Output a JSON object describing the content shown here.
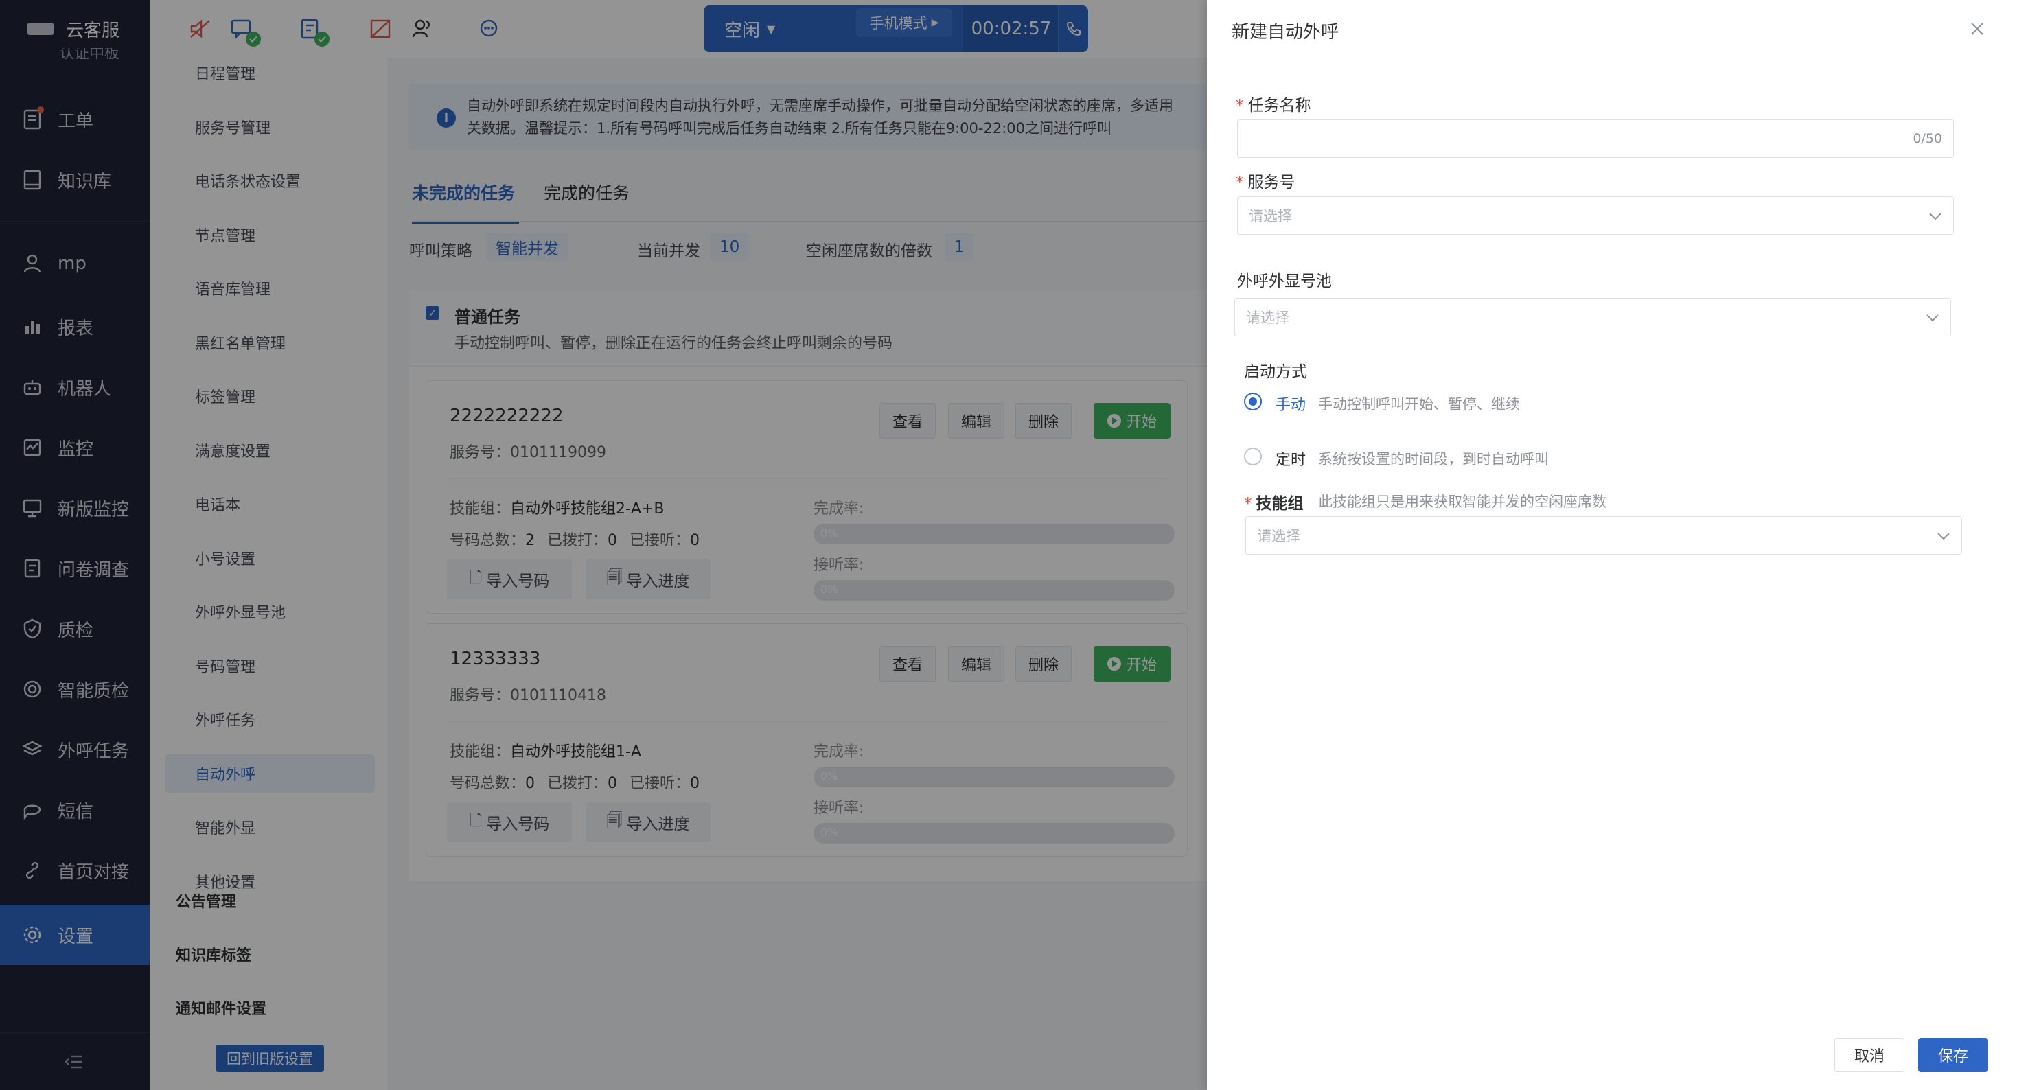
{
  "brand": {
    "title": "云客服",
    "partial_above": "认证中板"
  },
  "nav": {
    "items": [
      {
        "label": "工单",
        "icon": "ticket-icon"
      },
      {
        "label": "知识库",
        "icon": "book-icon"
      },
      {
        "label": "mp",
        "icon": "user-icon"
      },
      {
        "label": "报表",
        "icon": "bar-chart-icon"
      },
      {
        "label": "机器人",
        "icon": "robot-icon"
      },
      {
        "label": "监控",
        "icon": "monitor-icon"
      },
      {
        "label": "新版监控",
        "icon": "screen-icon"
      },
      {
        "label": "问卷调查",
        "icon": "survey-icon"
      },
      {
        "label": "质检",
        "icon": "shield-icon"
      },
      {
        "label": "智能质检",
        "icon": "target-icon"
      },
      {
        "label": "外呼任务",
        "icon": "layers-icon"
      },
      {
        "label": "短信",
        "icon": "message-icon"
      },
      {
        "label": "首页对接",
        "icon": "link-icon"
      },
      {
        "label": "设置",
        "icon": "gear-icon"
      }
    ],
    "collapse_icon": "menu-fold-icon"
  },
  "callbar": {
    "status": "空闲",
    "mode": "手机模式",
    "timer": "00:02:57"
  },
  "submenu": {
    "items": [
      "日程管理",
      "服务号管理",
      "电话条状态设置",
      "节点管理",
      "语音库管理",
      "黑红名单管理",
      "标签管理",
      "满意度设置",
      "电话本",
      "小号设置",
      "外呼外显号池",
      "号码管理",
      "外呼任务",
      "自动外呼",
      "智能外显",
      "其他设置"
    ],
    "groups": [
      "公告管理",
      "知识库标签",
      "通知邮件设置"
    ],
    "old_button": "回到旧版设置"
  },
  "main": {
    "info_line1": "自动外呼即系统在规定时间段内自动执行外呼，无需座席手动操作，可批量自动分配给空闲状态的座席，多适用",
    "info_line2": "关数据。温馨提示：1.所有号码呼叫完成后任务自动结束 2.所有任务只能在9:00-22:00之间进行呼叫",
    "tabs": [
      "未完成的任务",
      "完成的任务"
    ],
    "strategy_label": "呼叫策略",
    "strategy_value": "智能并发",
    "concurrency_label": "当前并发",
    "concurrency_value": "10",
    "multiplier_label": "空闲座席数的倍数",
    "multiplier_value": "1",
    "group_title": "普通任务",
    "group_desc": "手动控制呼叫、暂停，删除正在运行的任务会终止呼叫剩余的号码",
    "buttons": {
      "view": "查看",
      "edit": "编辑",
      "delete": "删除",
      "start": "开始",
      "import_numbers": "导入号码",
      "import_progress": "导入进度"
    },
    "labels": {
      "service_no": "服务号：",
      "skill_group": "技能组：",
      "total": "号码总数：",
      "dialed": "已拨打：",
      "answered": "已接听：",
      "completion": "完成率:",
      "answer_rate": "接听率:"
    },
    "tasks": [
      {
        "number": "2222222222",
        "service": "0101119099",
        "skill": "自动外呼技能组2-A+B",
        "total": "2",
        "dialed": "0",
        "answered": "0",
        "completion_pct": "0%",
        "answer_pct": "0%",
        "completion": 0,
        "answer": 0
      },
      {
        "number": "12333333",
        "service": "0101110418",
        "skill": "自动外呼技能组1-A",
        "total": "0",
        "dialed": "0",
        "answered": "0",
        "completion_pct": "0%",
        "answer_pct": "0%",
        "completion": 0,
        "answer": 0
      }
    ]
  },
  "drawer": {
    "title": "新建自动外呼",
    "task_name_label": "任务名称",
    "task_name_count": "0/50",
    "service_label": "服务号",
    "service_placeholder": "请选择",
    "pool_label": "外呼外显号池",
    "pool_placeholder": "请选择",
    "start_mode_label": "启动方式",
    "manual_label": "手动",
    "manual_desc": "手动控制呼叫开始、暂停、继续",
    "timed_label": "定时",
    "timed_desc": "系统按设置的时间段，到时自动呼叫",
    "skill_label": "技能组",
    "skill_desc": "此技能组只是用来获取智能并发的空闲座席数",
    "skill_placeholder": "请选择",
    "cancel": "取消",
    "save": "保存"
  },
  "colors": {
    "accent": "#2f66c6",
    "success": "#3fb360",
    "nav_bg": "#1f2536",
    "required": "#e74c3c"
  }
}
